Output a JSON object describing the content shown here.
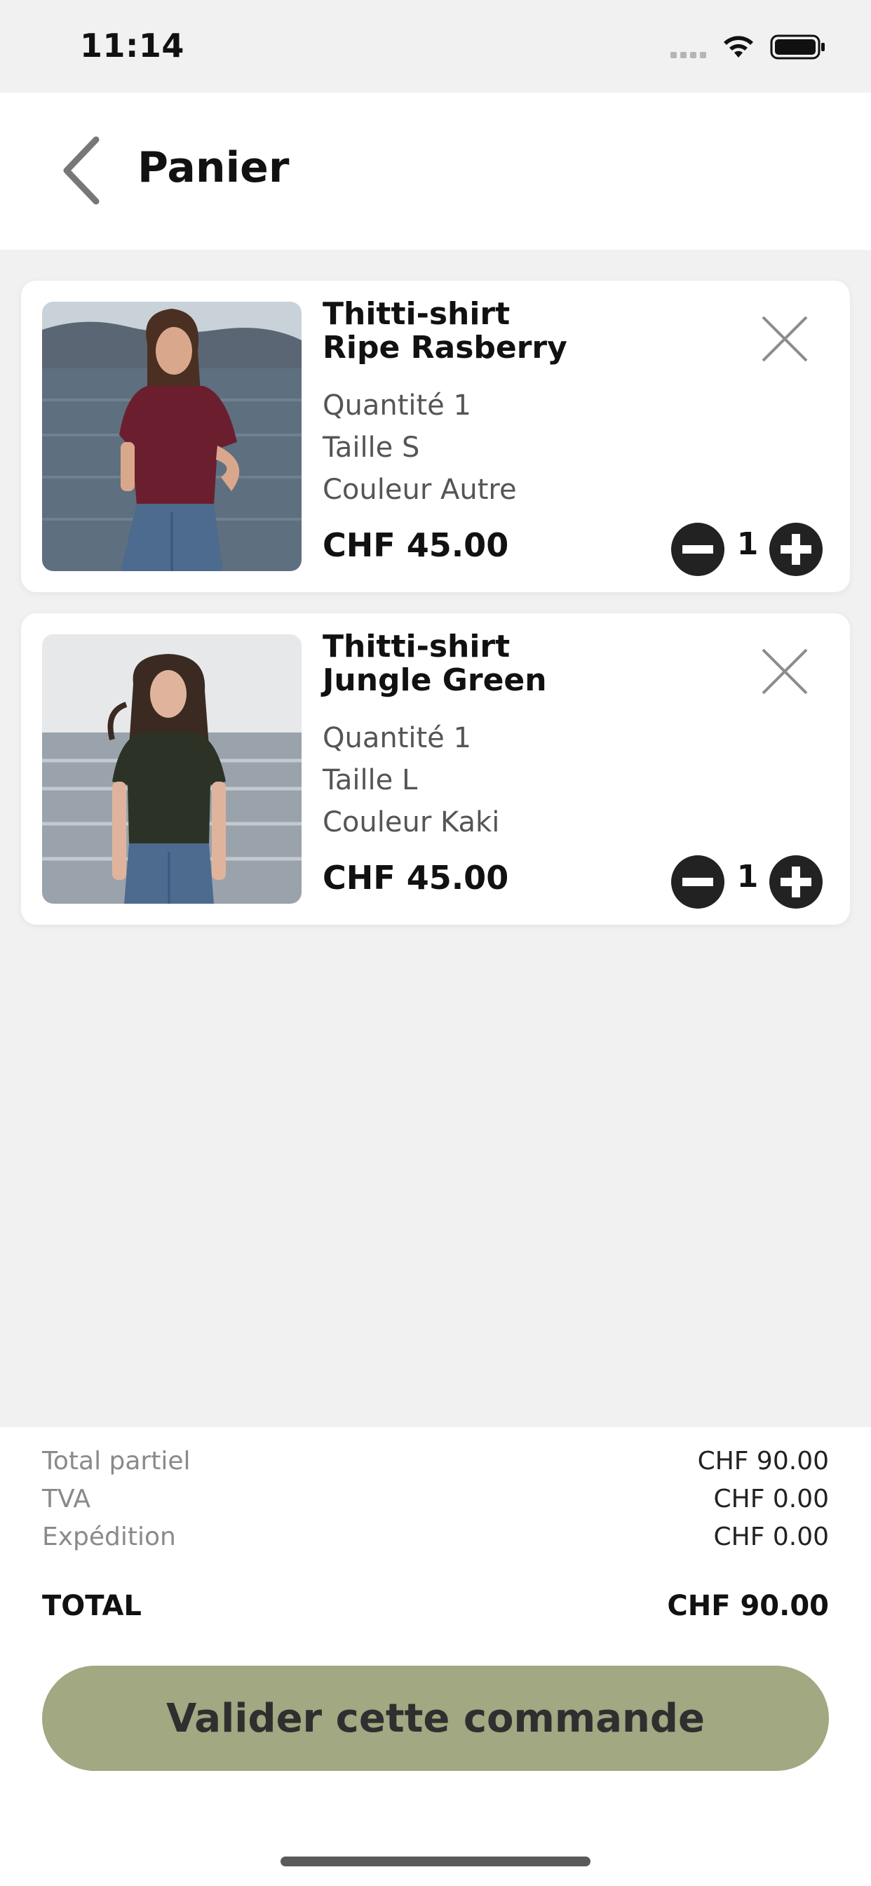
{
  "status_bar": {
    "time": "11:14"
  },
  "header": {
    "title": "Panier"
  },
  "cart_items": [
    {
      "name_line1": "Thitti-shirt",
      "name_line2": "Ripe Rasberry",
      "quantity_label": "Quantité 1",
      "size_label": "Taille S",
      "color_label": "Couleur Autre",
      "price": "CHF 45.00",
      "quantity": "1",
      "shirt_color": "#6b1f2e"
    },
    {
      "name_line1": "Thitti-shirt",
      "name_line2": "Jungle Green",
      "quantity_label": "Quantité 1",
      "size_label": "Taille L",
      "color_label": "Couleur Kaki",
      "price": "CHF 45.00",
      "quantity": "1",
      "shirt_color": "#2c3326"
    }
  ],
  "summary": {
    "subtotal_label": "Total partiel",
    "subtotal_value": "CHF 90.00",
    "tax_label": "TVA",
    "tax_value": "CHF 0.00",
    "shipping_label": "Expédition",
    "shipping_value": "CHF 0.00",
    "total_label": "TOTAL",
    "total_value": "CHF 90.00"
  },
  "checkout_button": {
    "label": "Valider cette commande"
  },
  "colors": {
    "accent": "#a1a882",
    "background": "#f1f1f1",
    "icon_dark": "#222222"
  }
}
